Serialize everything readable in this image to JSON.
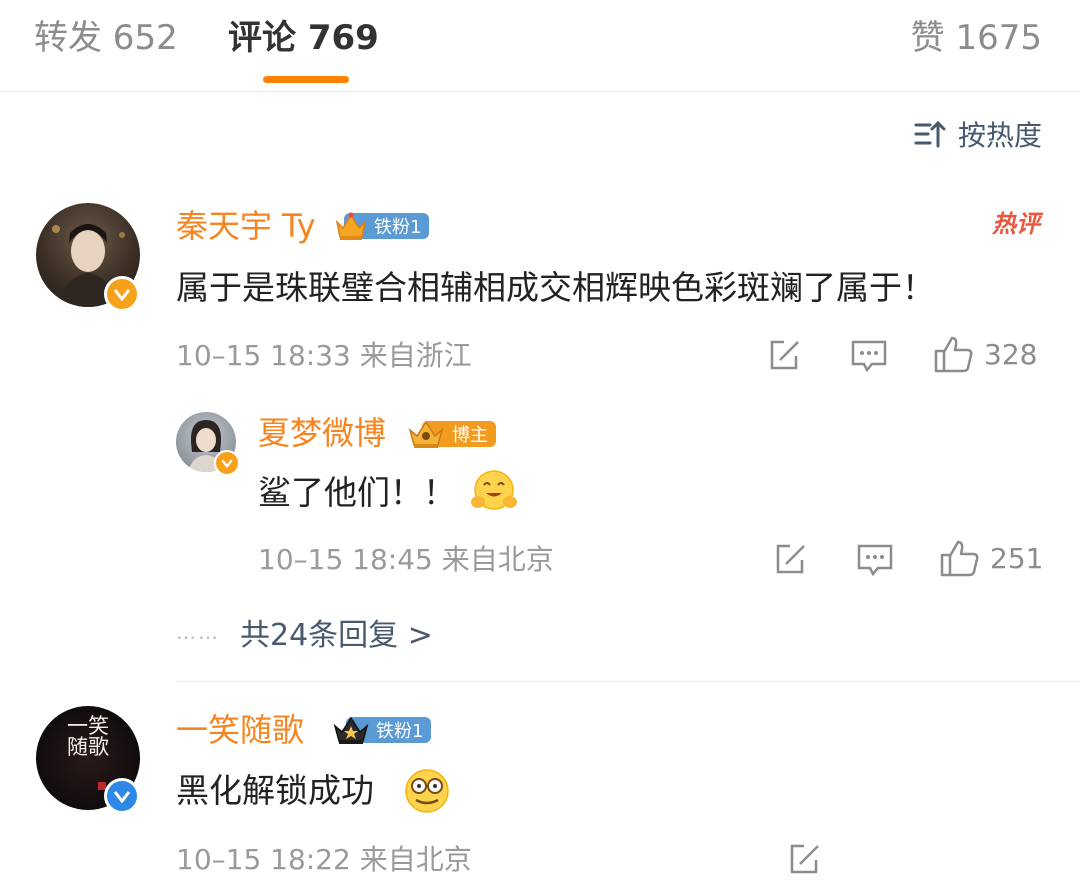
{
  "tabs": {
    "forward": "转发 652",
    "comments": "评论 769",
    "likes": "赞 1675"
  },
  "sort_label": "按热度",
  "colors": {
    "accent": "#ff8200",
    "username": "#f7841e",
    "link": "#48596e"
  },
  "comments": [
    {
      "username": "秦天宇 Ty",
      "fan_badge": "铁粉1",
      "hot_tag": "热评",
      "text": "属于是珠联璧合相辅相成交相辉映色彩斑斓了属于！",
      "meta": "10–15 18:33 来自浙江",
      "likes": "328",
      "verified": "orange"
    },
    {
      "username": "一笑随歌",
      "fan_badge": "铁粉1",
      "text": "黑化解锁成功",
      "emoji": "grimace-emoji",
      "meta": "10–15 18:22 来自北京",
      "verified": "blue",
      "avatar_text": "一笑随歌"
    }
  ],
  "reply": {
    "username": "夏梦微博",
    "badge": "博主",
    "text": "鲨了他们！！",
    "emoji": "hug-emoji",
    "meta": "10–15 18:45 来自北京",
    "likes": "251"
  },
  "more_replies": {
    "dots": "……",
    "label": "共24条回复 >"
  }
}
